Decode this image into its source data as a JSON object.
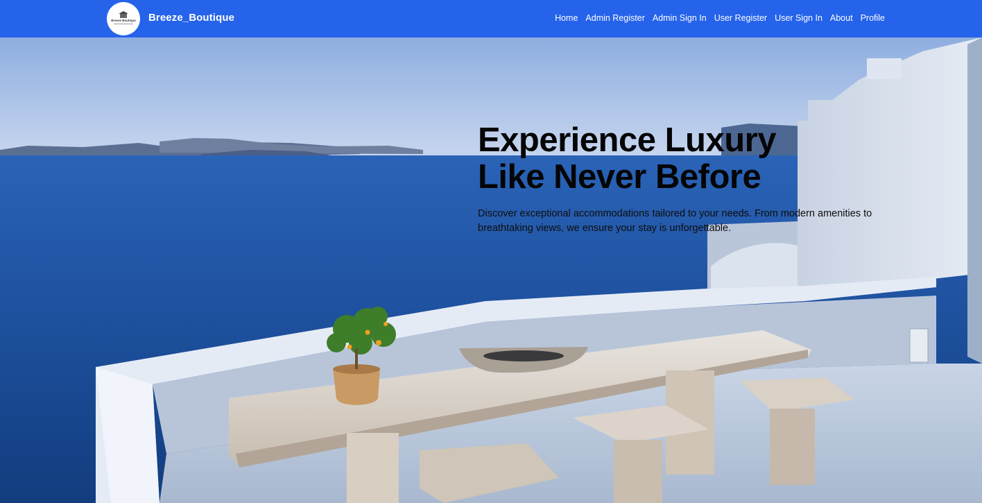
{
  "brand": {
    "name": "Breeze_Boutique",
    "logo_text": "Breeze Boutique"
  },
  "nav": {
    "items": [
      {
        "label": "Home"
      },
      {
        "label": "Admin Register"
      },
      {
        "label": "Admin Sign In"
      },
      {
        "label": "User Register"
      },
      {
        "label": "User Sign In"
      },
      {
        "label": "About"
      },
      {
        "label": "Profile"
      }
    ]
  },
  "hero": {
    "title": "Experience Luxury\nLike Never Before",
    "description": "Discover exceptional accommodations tailored to your needs. From modern amenities to breathtaking views, we ensure your stay is unforgettable."
  },
  "colors": {
    "navbar": "#2563eb",
    "nav_text": "#ffffff",
    "sea": "#1d57a8"
  }
}
